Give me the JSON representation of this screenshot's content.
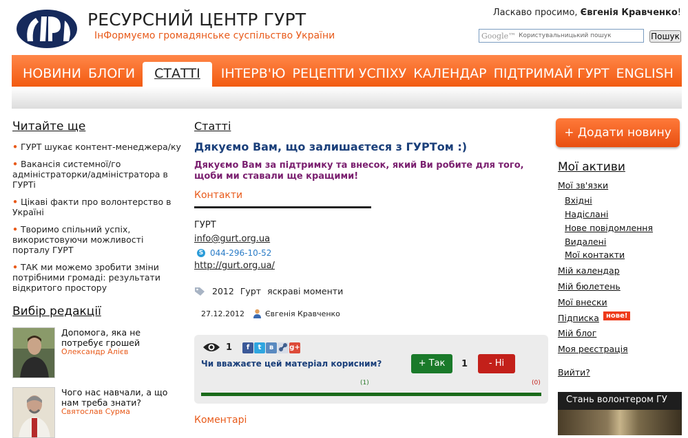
{
  "header": {
    "site_title": "РЕСУРСНИЙ ЦЕНТР ГУРТ",
    "tagline": "ІнФормуємо громадянське суспільство України",
    "welcome_prefix": "Ласкаво просимо,",
    "user_name": "Євгенія Кравченко",
    "welcome_suffix": "!",
    "search_brand": "Google™",
    "search_placeholder": "Користувальницький пошук",
    "search_button": "Пошук"
  },
  "nav": {
    "items": [
      "НОВИНИ",
      "БЛОГИ",
      "СТАТТІ",
      "ІНТЕРВ'Ю",
      "РЕЦЕПТИ УСПІХУ",
      "КАЛЕНДАР",
      "ПІДТРИМАЙ ГУРТ",
      "ENGLISH"
    ],
    "active": "СТАТТІ"
  },
  "left": {
    "read_more_heading": "Читайте ще",
    "read_more": [
      "ГУРТ шукає контент-менеджера/ку",
      "Вакансія системної/го адміністраторки/адміністратора в ГУРТі",
      "Цікаві факти про волонтерство в Україні",
      "Творимо спільний успіх, використовуючи можливості порталу ГУРТ",
      "ТАК ми можемо зробити зміни потрібними громаді: результати відкритого простору"
    ],
    "editors_heading": "Вибір редакції",
    "editors": [
      {
        "title": "Допомога, яка не потребує грошей",
        "author": "Олександр Алієв"
      },
      {
        "title": "Чого нас навчали, а що нам треба знати?",
        "author": "Святослав Сурма"
      }
    ]
  },
  "article": {
    "breadcrumb": "Статті",
    "title": "Дякуємо Вам, що залишаєтеся з ГУРТом :)",
    "lead": "Дякуємо Вам за підтримку та внесок, який Ви робите для того, щоби ми ставали ще кращими!",
    "contacts_heading": "Контакти",
    "org": "ГУРТ",
    "email": "info@gurt.org.ua",
    "phone": "044-296-10-52",
    "website": "http://gurt.org.ua/",
    "tags": [
      "2012",
      "Гурт",
      "яскраві моменти"
    ],
    "date": "27.12.2012",
    "author": "Євгенія Кравченко",
    "comments_heading": "Коментарі"
  },
  "vote": {
    "views": "1",
    "question": "Чи вважаєте цей матеріал корисним?",
    "yes_label": "+ Так",
    "yes_count": "1",
    "no_label": "- Ні",
    "yes_small": "(1)",
    "no_small": "(0)",
    "yes_ratio": 1.0
  },
  "right": {
    "add_news": "+ Додати новину",
    "my_assets_heading": "Мої активи",
    "my_links_heading": "Мої зв'язки",
    "links_sub": [
      "Вхідні",
      "Надіслані",
      "Нове повідомлення",
      "Видалені",
      "Мої контакти"
    ],
    "links_main": [
      "Мій календар",
      "Мій бюлетень",
      "Мої внески",
      "Підписка",
      "Мій блог",
      "Моя реєстрація"
    ],
    "new_badge": "нове!",
    "logout": "Вийти?",
    "volunteer": "Стань волонтером ГУ"
  },
  "colors": {
    "accent": "#f25a10",
    "title_blue": "#1a3f7a",
    "lead_purple": "#7a1f6f",
    "yes_green": "#1a7a2a",
    "no_red": "#c3201a"
  }
}
